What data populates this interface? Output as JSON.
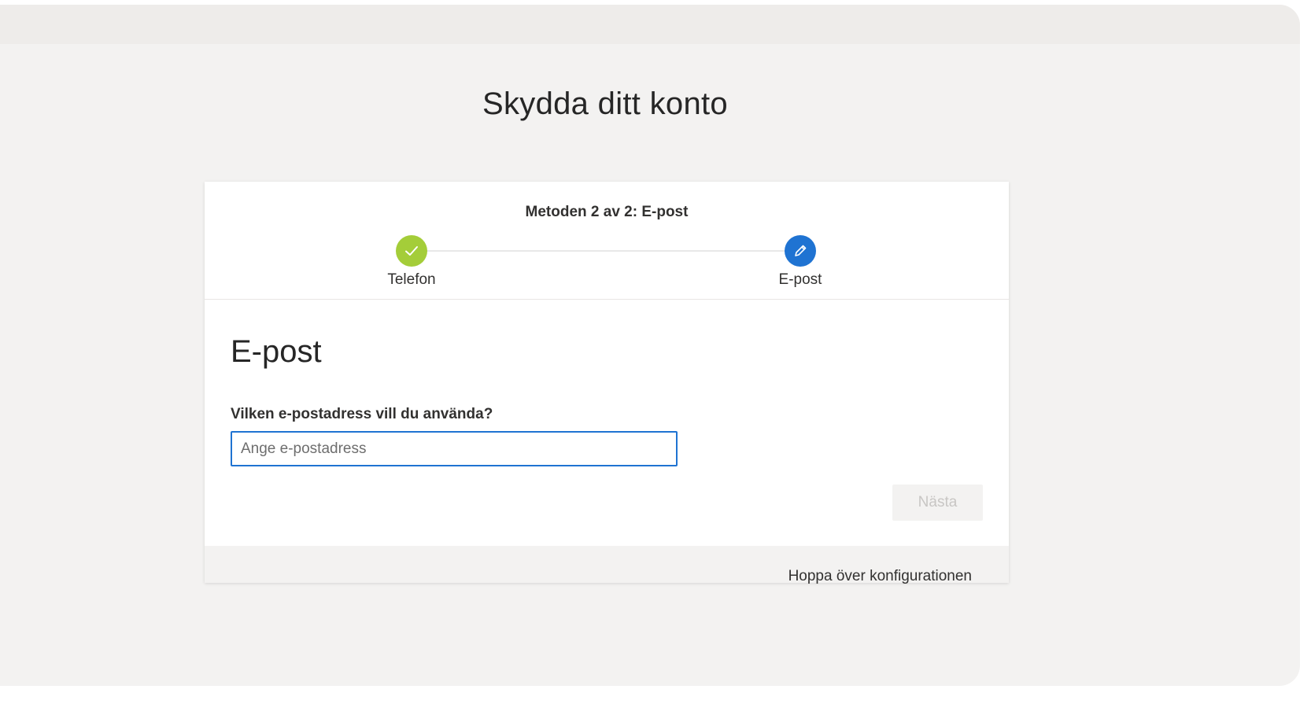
{
  "page": {
    "title": "Skydda ditt konto"
  },
  "progress": {
    "caption": "Metoden 2 av 2: E-post",
    "steps": [
      {
        "label": "Telefon",
        "state": "completed",
        "icon": "checkmark-icon",
        "color": "#a4cd39"
      },
      {
        "label": "E-post",
        "state": "active",
        "icon": "pencil-icon",
        "color": "#1f73d2"
      }
    ]
  },
  "form": {
    "heading": "E-post",
    "question": "Vilken e-postadress vill du använda?",
    "email_value": "",
    "email_placeholder": "Ange e-postadress",
    "next_label": "Nästa"
  },
  "footer": {
    "skip_label": "Hoppa över konfigurationen"
  },
  "colors": {
    "accent": "#1f73d2",
    "success": "#a4cd39",
    "background": "#f3f2f1"
  }
}
